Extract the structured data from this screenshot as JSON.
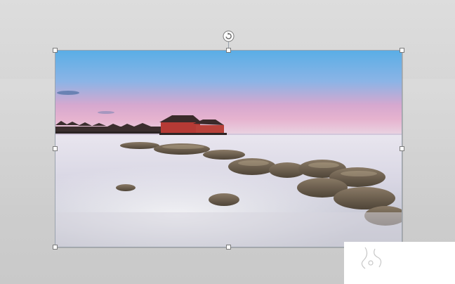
{
  "editor": {
    "canvas_background": "#d6d6d6",
    "selected_object": {
      "type": "picture",
      "image_description_icon": "seascape-photo",
      "selection_handles": [
        "top-left",
        "top-center",
        "top-right",
        "middle-left",
        "middle-right",
        "bottom-left",
        "bottom-center",
        "bottom-right"
      ],
      "rotate_handle_icon": "rotate-icon"
    }
  },
  "colors": {
    "handle_fill": "#ffffff",
    "handle_border": "#7a7a7a",
    "selection_border": "#9aa3ad"
  }
}
